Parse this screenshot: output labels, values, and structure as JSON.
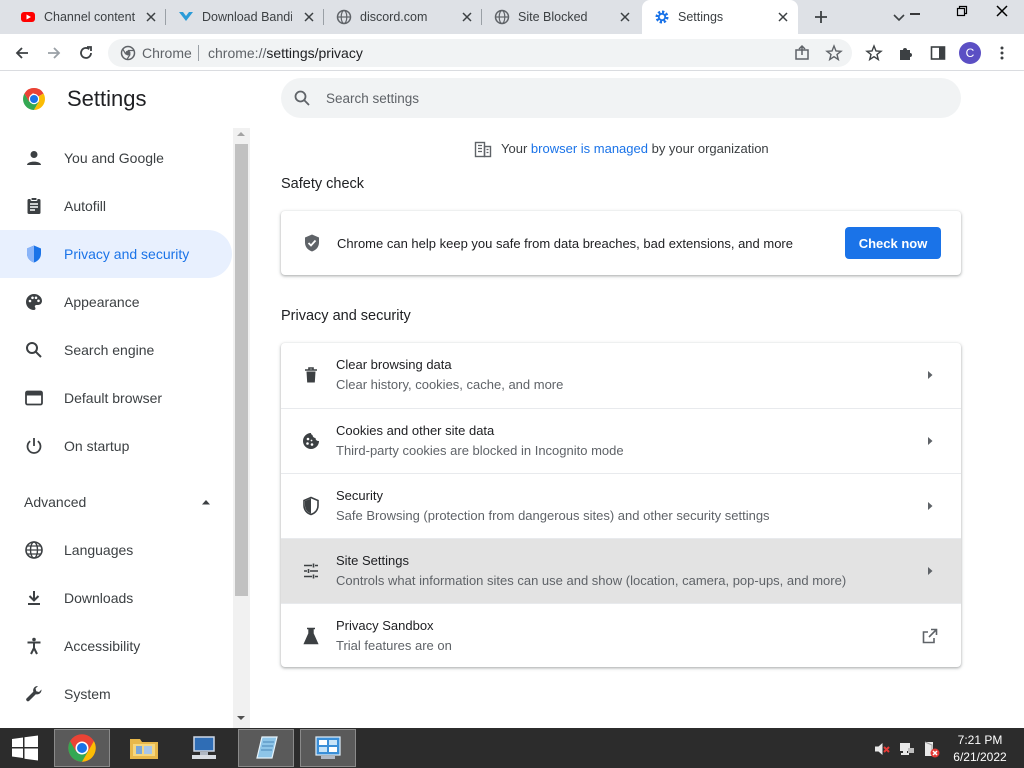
{
  "tabs": [
    {
      "label": "Channel content",
      "icon": "youtube-icon"
    },
    {
      "label": "Download Bandicam",
      "icon": "bandicam-icon"
    },
    {
      "label": "discord.com",
      "icon": "globe-icon"
    },
    {
      "label": "Site Blocked",
      "icon": "globe-icon"
    },
    {
      "label": "Settings",
      "icon": "gear-icon"
    }
  ],
  "omnibox": {
    "site_label": "Chrome",
    "url_scheme": "chrome://",
    "url_path": "settings/privacy"
  },
  "avatar_initial": "C",
  "header": {
    "title": "Settings",
    "search_placeholder": "Search settings"
  },
  "managed": {
    "prefix": "Your",
    "link": "browser is managed",
    "suffix": "by your organization"
  },
  "sidebar": {
    "items": [
      {
        "label": "You and Google",
        "icon": "person-icon"
      },
      {
        "label": "Autofill",
        "icon": "clipboard-icon"
      },
      {
        "label": "Privacy and security",
        "icon": "shield-icon",
        "active": true
      },
      {
        "label": "Appearance",
        "icon": "palette-icon"
      },
      {
        "label": "Search engine",
        "icon": "search-icon"
      },
      {
        "label": "Default browser",
        "icon": "browser-icon"
      },
      {
        "label": "On startup",
        "icon": "power-icon"
      }
    ],
    "advanced_label": "Advanced",
    "advanced_items": [
      {
        "label": "Languages",
        "icon": "globe-icon"
      },
      {
        "label": "Downloads",
        "icon": "download-icon"
      },
      {
        "label": "Accessibility",
        "icon": "accessibility-icon"
      },
      {
        "label": "System",
        "icon": "wrench-icon"
      }
    ]
  },
  "safety_check": {
    "title": "Safety check",
    "text": "Chrome can help keep you safe from data breaches, bad extensions, and more",
    "button": "Check now"
  },
  "privacy": {
    "title": "Privacy and security",
    "rows": [
      {
        "title": "Clear browsing data",
        "subtitle": "Clear history, cookies, cache, and more",
        "icon": "trash-icon"
      },
      {
        "title": "Cookies and other site data",
        "subtitle": "Third-party cookies are blocked in Incognito mode",
        "icon": "cookie-icon"
      },
      {
        "title": "Security",
        "subtitle": "Safe Browsing (protection from dangerous sites) and other security settings",
        "icon": "shield-icon"
      },
      {
        "title": "Site Settings",
        "subtitle": "Controls what information sites can use and show (location, camera, pop-ups, and more)",
        "icon": "tune-icon"
      },
      {
        "title": "Privacy Sandbox",
        "subtitle": "Trial features are on",
        "icon": "flask-icon"
      }
    ]
  },
  "taskbar": {
    "time": "7:21 PM",
    "date": "6/21/2022"
  },
  "colors": {
    "accent": "#1a73e8",
    "active_nav_bg": "#e8f0fe",
    "tabstrip_bg": "#dee1e6",
    "taskbar_bg": "#2c2c2c"
  }
}
